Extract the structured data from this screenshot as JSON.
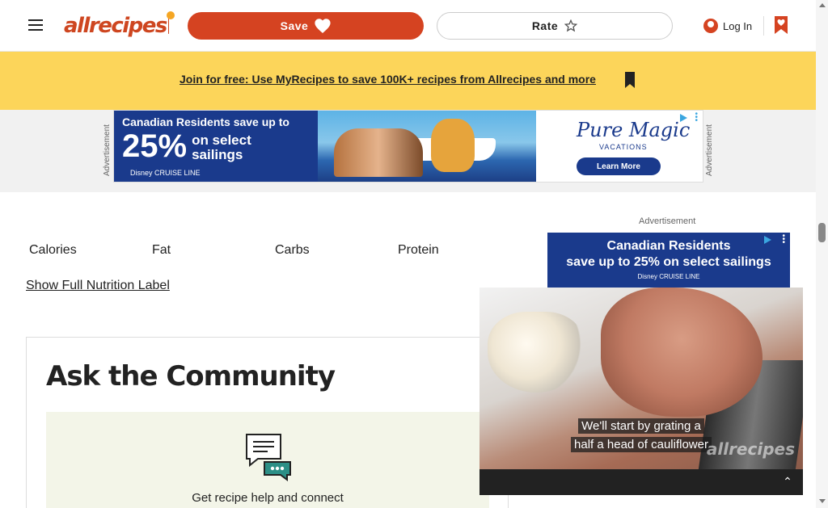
{
  "header": {
    "logo_text": "allrecipes",
    "save_label": "Save",
    "rate_label": "Rate",
    "login_label": "Log In"
  },
  "banner": {
    "link_text": "Join for free: Use MyRecipes to save 100K+ recipes from Allrecipes and more"
  },
  "ads": {
    "side_label": "Advertisement",
    "label": "Advertisement",
    "top_ad": {
      "line1": "Canadian Residents save up to",
      "percent": "25%",
      "line2": "on select sailings",
      "brand": "Disney CRUISE LINE",
      "partner": "Pure Magic",
      "partner_sub": "VACATIONS",
      "cta": "Learn More"
    },
    "right_ad": {
      "line1": "Canadian Residents",
      "line2": "save up to 25% on select sailings",
      "brand": "Disney CRUISE LINE"
    }
  },
  "nutrition": {
    "items": [
      {
        "label": "Calories",
        "value": ""
      },
      {
        "label": "Fat",
        "value": ""
      },
      {
        "label": "Carbs",
        "value": ""
      },
      {
        "label": "Protein",
        "value": ""
      }
    ],
    "show_full_label": "Show Full Nutrition Label"
  },
  "community": {
    "title": "Ask the Community",
    "text": "Get recipe help and connect"
  },
  "video": {
    "caption_line1": "We'll start by grating a",
    "caption_line2": "half a head of cauliflower",
    "watermark": "allrecipes"
  }
}
